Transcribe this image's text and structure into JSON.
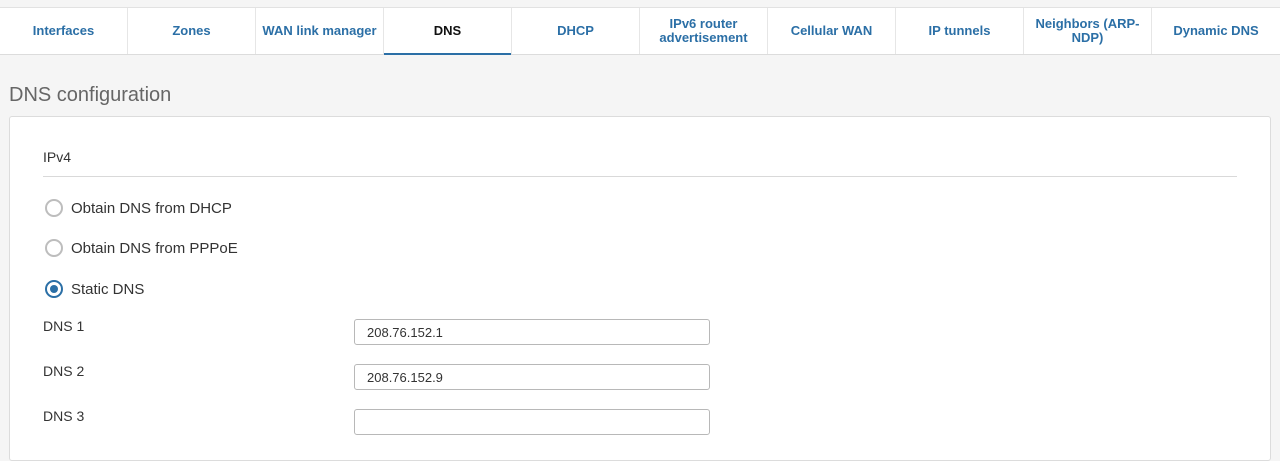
{
  "tabs": [
    {
      "label": "Interfaces",
      "active": false
    },
    {
      "label": "Zones",
      "active": false
    },
    {
      "label": "WAN link manager",
      "active": false
    },
    {
      "label": "DNS",
      "active": true
    },
    {
      "label": "DHCP",
      "active": false
    },
    {
      "label": "IPv6 router advertisement",
      "active": false
    },
    {
      "label": "Cellular WAN",
      "active": false
    },
    {
      "label": "IP tunnels",
      "active": false
    },
    {
      "label": "Neighbors (ARP-NDP)",
      "active": false
    },
    {
      "label": "Dynamic DNS",
      "active": false
    }
  ],
  "page_title": "DNS configuration",
  "section": {
    "title": "IPv4"
  },
  "radios": [
    {
      "label": "Obtain DNS from DHCP",
      "checked": false
    },
    {
      "label": "Obtain DNS from PPPoE",
      "checked": false
    },
    {
      "label": "Static DNS",
      "checked": true
    }
  ],
  "fields": [
    {
      "label": "DNS 1",
      "value": "208.76.152.1"
    },
    {
      "label": "DNS 2",
      "value": "208.76.152.9"
    },
    {
      "label": "DNS 3",
      "value": ""
    }
  ],
  "colors": {
    "accent": "#2b6fa6",
    "text": "#333333",
    "background": "#f5f5f5"
  }
}
